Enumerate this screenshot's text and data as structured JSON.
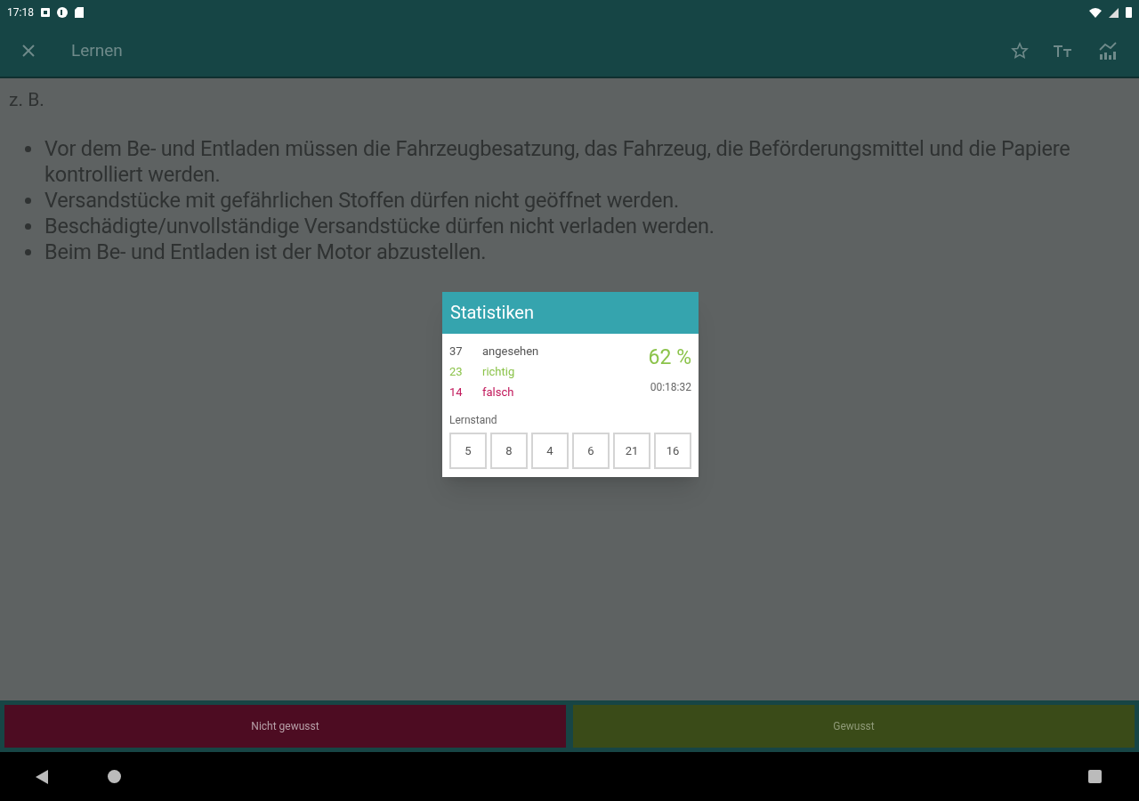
{
  "status_bar": {
    "time": "17:18"
  },
  "app_bar": {
    "title": "Lernen"
  },
  "content": {
    "intro": "z. B.",
    "bullets": [
      "Vor dem Be- und Entladen müssen die Fahrzeugbesatzung, das Fahrzeug, die Beförderungsmittel und die Papiere kontrolliert werden.",
      "Versandstücke mit gefährlichen Stoffen dürfen nicht geöffnet werden.",
      "Beschädigte/unvollständige Versandstücke dürfen nicht verladen werden.",
      "Beim Be- und Entladen ist der Motor abzustellen."
    ]
  },
  "dialog": {
    "title": "Statistiken",
    "counts": [
      {
        "number": "37",
        "label": "angesehen",
        "color": "#555555"
      },
      {
        "number": "23",
        "label": "richtig",
        "color": "#8bc34a"
      },
      {
        "number": "14",
        "label": "falsch",
        "color": "#c2185b"
      }
    ],
    "percent": "62 %",
    "duration": "00:18:32",
    "progress_label": "Lernstand",
    "levels": [
      "5",
      "8",
      "4",
      "6",
      "21",
      "16"
    ]
  },
  "buttons": [
    {
      "label": "Nicht gewusst",
      "kind": "wrong"
    },
    {
      "label": "Gewusst",
      "kind": "right"
    }
  ]
}
